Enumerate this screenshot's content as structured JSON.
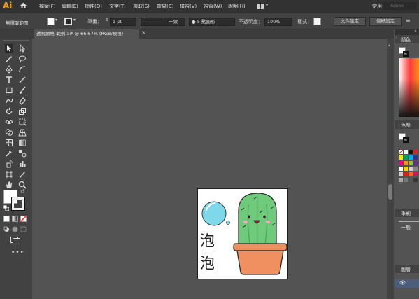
{
  "app": {
    "logo": "Ai",
    "workspace": "常用",
    "search_placeholder": "Adobe"
  },
  "menu": [
    "檔案(F)",
    "編輯(E)",
    "物件(O)",
    "文字(T)",
    "選取(S)",
    "效果(C)",
    "檢視(V)",
    "視窗(W)",
    "說明(H)"
  ],
  "control_bar": {
    "selection_status": "無選取範圍",
    "stroke_label": "筆畫：",
    "stroke_weight": "1 pt",
    "line_style": "一致",
    "brush": "5 點圓形",
    "opacity_label": "不透明度：",
    "opacity_value": "100%",
    "style_label": "樣式：",
    "doc_setup_button": "文件設定",
    "preferences_button": "偏好設定"
  },
  "document_tab": {
    "title": "透視網格-範例.ai* @ 66.67% (RGB/預視)",
    "close": "×"
  },
  "panels": {
    "color": "顏色",
    "swatches": "色票",
    "brushes": "筆刷",
    "brush_item": "一般",
    "layers": "圖層"
  },
  "artwork": {
    "text_line1": "泡",
    "text_line2": "泡"
  },
  "colors": {
    "menubar": "#323232",
    "workspace": "#535353",
    "cactus": "#6fcb7b",
    "pot": "#f08f5f",
    "bubble": "#7fd8ea",
    "accent_logo": "#ff9a00"
  }
}
